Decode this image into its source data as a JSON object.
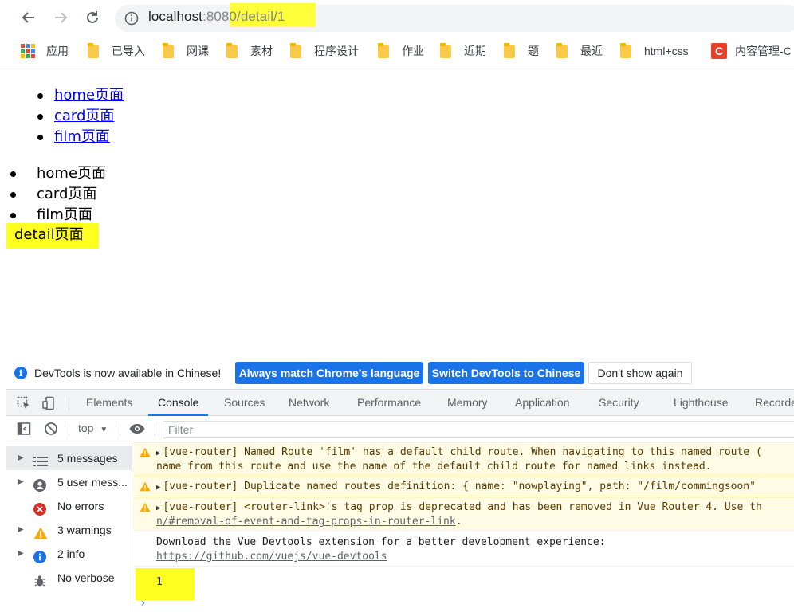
{
  "browser": {
    "url_host": "localhost",
    "url_port": ":8080",
    "url_path": "/detail/1",
    "bookmarks": [
      {
        "label": "应用",
        "icon": "apps-icon"
      },
      {
        "label": "已导入",
        "icon": "folder-icon"
      },
      {
        "label": "网课",
        "icon": "folder-icon"
      },
      {
        "label": "素材",
        "icon": "folder-icon"
      },
      {
        "label": "程序设计",
        "icon": "folder-icon"
      },
      {
        "label": "作业",
        "icon": "folder-icon"
      },
      {
        "label": "近期",
        "icon": "folder-icon"
      },
      {
        "label": "题",
        "icon": "folder-icon"
      },
      {
        "label": "最近",
        "icon": "folder-icon"
      },
      {
        "label": "html+css",
        "icon": "folder-icon"
      },
      {
        "label": "内容管理-C",
        "icon": "csdn-icon"
      }
    ],
    "highlight_color": "#ffff1f"
  },
  "page": {
    "nav_links": [
      "home页面",
      "card页面",
      "film页面"
    ],
    "views": [
      "home页面",
      "card页面",
      "film页面"
    ],
    "detail_text": "detail页面"
  },
  "devtools": {
    "infobar": {
      "text": "DevTools is now available in Chinese!",
      "btn_match": "Always match Chrome's language",
      "btn_switch": "Switch DevTools to Chinese",
      "btn_dismiss": "Don't show again"
    },
    "tabs": [
      "Elements",
      "Console",
      "Sources",
      "Network",
      "Performance",
      "Memory",
      "Application",
      "Security",
      "Lighthouse",
      "Recorder"
    ],
    "active_tab": "Console",
    "context": "top",
    "filter_placeholder": "Filter",
    "sidebar": [
      {
        "label": "5 messages",
        "icon": "list-icon"
      },
      {
        "label": "5 user mess...",
        "icon": "user-icon"
      },
      {
        "label": "No errors",
        "icon": "error-icon"
      },
      {
        "label": "3 warnings",
        "icon": "warning-icon"
      },
      {
        "label": "2 info",
        "icon": "info-icon"
      },
      {
        "label": "No verbose",
        "icon": "bug-icon"
      }
    ],
    "messages": {
      "warn1_line1": "[vue-router] Named Route 'film' has a default child route. When navigating to this named route (",
      "warn1_line2": "name from this route and use the name of the default child route for named links instead.",
      "warn2": "[vue-router] Duplicate named routes definition: { name: \"nowplaying\", path: \"/film/commingsoon\"",
      "warn3_line1": "[vue-router] <router-link>'s tag prop is deprecated and has been removed in Vue Router 4. Use th",
      "warn3_link": "n/#removal-of-event-and-tag-props-in-router-link",
      "warn3_suffix": ".",
      "info_line1": "Download the Vue Devtools extension for a better development experience:",
      "info_link": "https://github.com/vuejs/vue-devtools",
      "result": "1"
    }
  }
}
